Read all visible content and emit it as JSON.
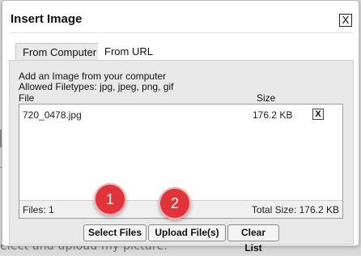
{
  "background": {
    "text": "elect and upload my picture."
  },
  "dialog": {
    "title": "Insert Image",
    "close_label": "X",
    "tabs": [
      {
        "label": "From Computer",
        "active": true
      },
      {
        "label": "From URL",
        "active": false
      }
    ],
    "intro": "Add an Image from your computer",
    "allowed": "Allowed Filetypes: jpg, jpeg, png, gif",
    "columns": {
      "file": "File",
      "size": "Size"
    },
    "files": [
      {
        "name": "720_0478.jpg",
        "size": "176.2 KB",
        "remove_label": "X"
      }
    ],
    "footer": {
      "files_count": "Files: 1",
      "total_size": "Total Size: 176.2 KB"
    },
    "buttons": {
      "select": "Select Files",
      "upload": "Upload File(s)",
      "clear": "Clear List"
    }
  },
  "annotations": [
    {
      "label": "1",
      "color": "#e0343a"
    },
    {
      "label": "2",
      "color": "#e0343a"
    }
  ]
}
